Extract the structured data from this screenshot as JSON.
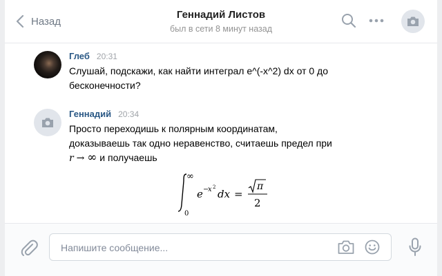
{
  "header": {
    "back_label": "Назад",
    "contact_name": "Геннадий Листов",
    "status": "был в сети 8 минут назад",
    "icons": [
      "chevron-left-icon",
      "search-icon",
      "more-icon",
      "camera-icon"
    ]
  },
  "messages": [
    {
      "author": "Глеб",
      "time": "20:31",
      "lines": [
        "Слушай, подскажи, как найти интеграл e^(-x^2) dx от 0 до",
        "бесконечности?"
      ]
    },
    {
      "author": "Геннадий",
      "time": "20:34",
      "lines": [
        "Просто переходишь к полярным координатам,",
        "доказываешь так одно неравенство, считаешь предел при"
      ],
      "math_line": {
        "var": "r",
        "arrow": "→",
        "inf": "∞",
        "rest": " и получаешь"
      },
      "formula": {
        "upper": "∞",
        "lower": "0",
        "base": "e",
        "exp_sign": "−",
        "exp_var": "x",
        "exp_pow": "2",
        "dx": "dx",
        "eq": "=",
        "num": "π",
        "den": "2"
      }
    }
  ],
  "composer": {
    "placeholder": "Напишите сообщение..."
  },
  "colors": {
    "author": "#2a5885",
    "secondary": "#939393",
    "icon": "#99a2ad"
  }
}
